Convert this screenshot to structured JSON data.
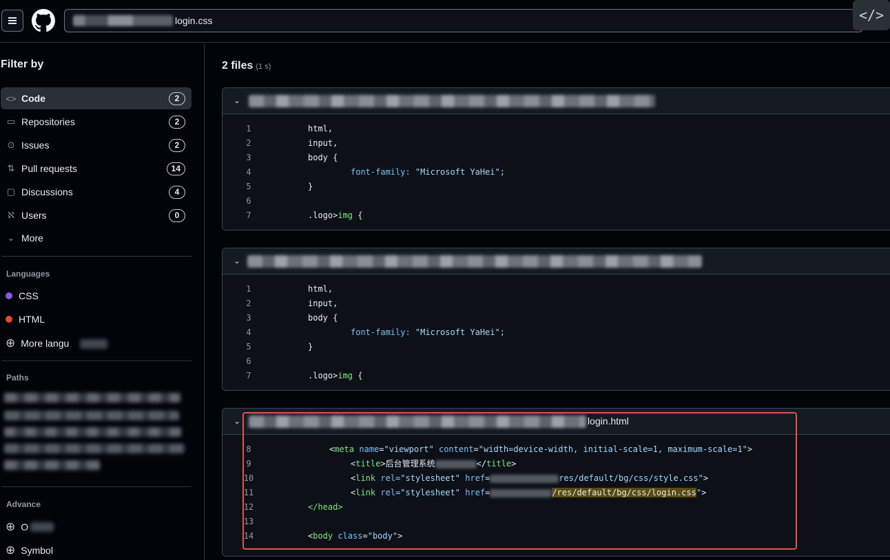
{
  "header": {
    "search_value": "login.css",
    "code_toggle_glyph": "</>"
  },
  "sidebar": {
    "filter_title": "Filter by",
    "types": [
      {
        "label": "Code",
        "count": "2",
        "icon": "<>"
      },
      {
        "label": "Repositories",
        "count": "2",
        "icon": "▭"
      },
      {
        "label": "Issues",
        "count": "2",
        "icon": "⊙"
      },
      {
        "label": "Pull requests",
        "count": "14",
        "icon": "⇅"
      },
      {
        "label": "Discussions",
        "count": "4",
        "icon": "▢"
      },
      {
        "label": "Users",
        "count": "0",
        "icon": "ℵ"
      },
      {
        "label": "More",
        "icon": "⌄"
      }
    ],
    "languages_title": "Languages",
    "languages": [
      {
        "label": "CSS",
        "color": "#8957e5"
      },
      {
        "label": "HTML",
        "color": "#e34c26"
      }
    ],
    "more_languages": "More langu",
    "paths_title": "Paths",
    "advanced_title": "Advance",
    "advanced": [
      {
        "label": "O"
      },
      {
        "label": "Symbol"
      }
    ]
  },
  "main": {
    "results_count": "2 files",
    "results_time": "(1 s)",
    "files": [
      {
        "path_suffix": "",
        "lines": [
          {
            "n": "1",
            "text": "html,"
          },
          {
            "n": "2",
            "text": "input,"
          },
          {
            "n": "3",
            "text": "body {"
          },
          {
            "n": "4",
            "prop": "font-family:",
            "value": " \"Microsoft YaHei\";"
          },
          {
            "n": "5",
            "text": "}"
          },
          {
            "n": "6",
            "text": ""
          },
          {
            "n": "7",
            "sel1": ".logo>",
            "sel2": "img",
            "rest": " {"
          }
        ]
      },
      {
        "path_suffix": "",
        "lines": [
          {
            "n": "1",
            "text": "html,"
          },
          {
            "n": "2",
            "text": "input,"
          },
          {
            "n": "3",
            "text": "body {"
          },
          {
            "n": "4",
            "prop": "font-family:",
            "value": " \"Microsoft YaHei\";"
          },
          {
            "n": "5",
            "text": "}"
          },
          {
            "n": "6",
            "text": ""
          },
          {
            "n": "7",
            "sel1": ".logo>",
            "sel2": "img",
            "rest": " {"
          }
        ]
      },
      {
        "path_suffix": "login.html",
        "lines": [
          {
            "n": "8",
            "a": "<",
            "b": "meta",
            "c": " name",
            "d": "=",
            "e": "\"viewport\"",
            "f": " content",
            "g": "=",
            "h": "\"width=device-width, initial-scale=1, maximum-scale=1\"",
            "i": ">"
          },
          {
            "n": "9",
            "t1": "<",
            "t2": "title",
            "t3": ">后台管理系统",
            "t4": "</",
            "t5": "title",
            "t6": ">"
          },
          {
            "n": "10",
            "l1": "<",
            "l2": "link",
            "l3": " rel",
            "l4": "=\"stylesheet\"",
            "l5": " href",
            "l6": "=",
            "l7": "res/default/bg/css/style.css\"",
            "l8": ">"
          },
          {
            "n": "11",
            "m1": "<",
            "m2": "link",
            "m3": " rel",
            "m4": "=\"stylesheet\"",
            "m5": " href",
            "m6": "=",
            "m7": "/res/default/bg/css/login.css",
            "m8": "\"",
            "m9": ">"
          },
          {
            "n": "12",
            "text": "</head>"
          },
          {
            "n": "13",
            "text": ""
          },
          {
            "n": "14",
            "b1": "<",
            "b2": "body",
            "b3": " class",
            "b4": "=",
            "b5": "\"body\"",
            "b6": ">"
          }
        ]
      }
    ]
  }
}
